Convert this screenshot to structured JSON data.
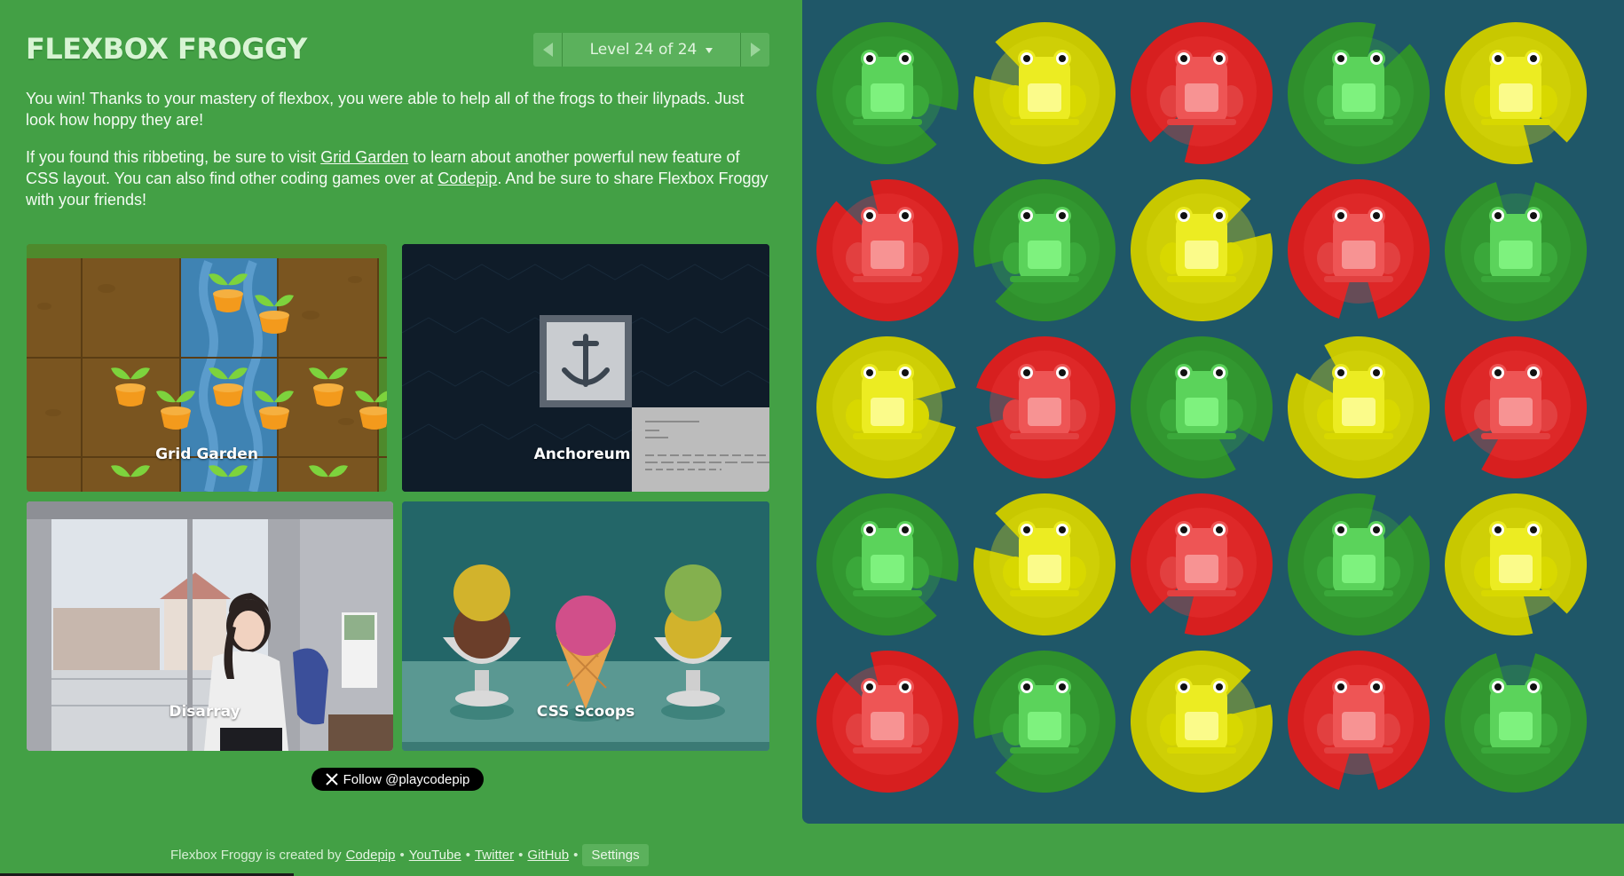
{
  "header": {
    "title": "FLEXBOX FROGGY",
    "level_label": "Level 24 of 24"
  },
  "instructions": {
    "p1": "You win! Thanks to your mastery of flexbox, you were able to help all of the frogs to their lilypads. Just look how hoppy they are!",
    "p2_before": "If you found this ribbeting, be sure to visit ",
    "p2_link1": "Grid Garden",
    "p2_middle": " to learn about another powerful new feature of CSS layout. You can also find other coding games over at ",
    "p2_link2": "Codepip",
    "p2_after": ". And be sure to share Flexbox Froggy with your friends!"
  },
  "games": [
    {
      "label": "Grid Garden"
    },
    {
      "label": "Anchoreum"
    },
    {
      "label": "Disarray"
    },
    {
      "label": "CSS Scoops"
    }
  ],
  "follow_button": "Follow @playcodepip",
  "footer": {
    "prefix": "Flexbox Froggy is created by",
    "links": [
      "Codepip",
      "YouTube",
      "Twitter",
      "GitHub"
    ],
    "separator": "•",
    "settings": "Settings"
  },
  "colors": {
    "background": "#43a045",
    "board": "#1f5768",
    "green_pad": "#2f8f2c",
    "yellow_pad": "#c8c800",
    "red_pad": "#d71f1f",
    "green_frog": "#5bd35b",
    "yellow_frog": "#ecec22",
    "red_frog": "#ee5555"
  },
  "board": {
    "rows": [
      [
        "green",
        "yellow",
        "red",
        "green",
        "yellow"
      ],
      [
        "red",
        "green",
        "yellow",
        "red",
        "green"
      ],
      [
        "yellow",
        "red",
        "green",
        "yellow",
        "red"
      ],
      [
        "green",
        "yellow",
        "red",
        "green",
        "yellow"
      ],
      [
        "red",
        "green",
        "yellow",
        "red",
        "green"
      ]
    ]
  }
}
